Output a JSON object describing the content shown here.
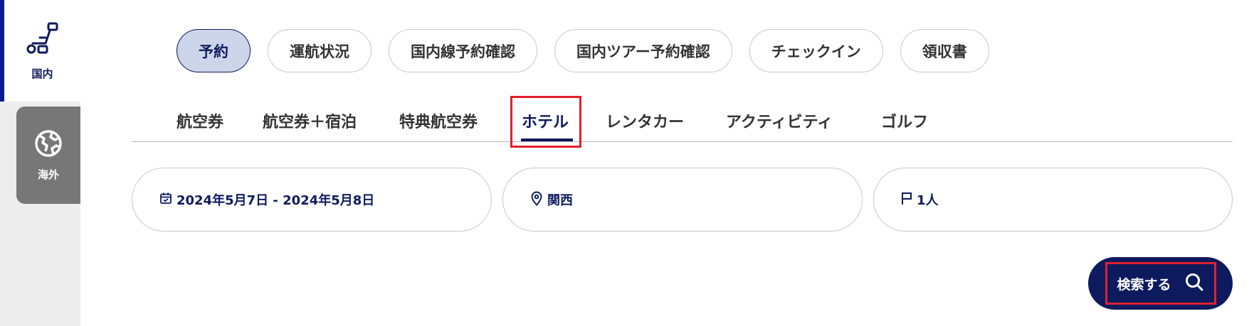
{
  "rail": {
    "domestic": {
      "label": "国内",
      "icon": "seat-icon"
    },
    "international": {
      "label": "海外",
      "icon": "globe-icon"
    }
  },
  "main_nav": {
    "items": [
      "予約",
      "運航状況",
      "国内線予約確認",
      "国内ツアー予約確認",
      "チェックイン",
      "領収書"
    ],
    "active": "予約"
  },
  "sub_tabs": {
    "items": [
      "航空券",
      "航空券＋宿泊",
      "特典航空券",
      "ホテル",
      "レンタカー",
      "アクティビティ",
      "ゴルフ"
    ],
    "active": "ホテル"
  },
  "search": {
    "dates": {
      "value": "2024年5月7日 - 2024年5月8日",
      "icon": "calendar-icon"
    },
    "destination": {
      "value": "関西",
      "icon": "location-pin-icon"
    },
    "guests": {
      "value": "1人",
      "icon": "flag-icon"
    },
    "button_label": "検索する",
    "button_icon": "search-icon"
  },
  "colors": {
    "brand_navy": "#0d1a5e",
    "active_pill_bg": "#ccd5ea",
    "highlight_red": "#e0202e",
    "rail_gray": "#777777"
  }
}
